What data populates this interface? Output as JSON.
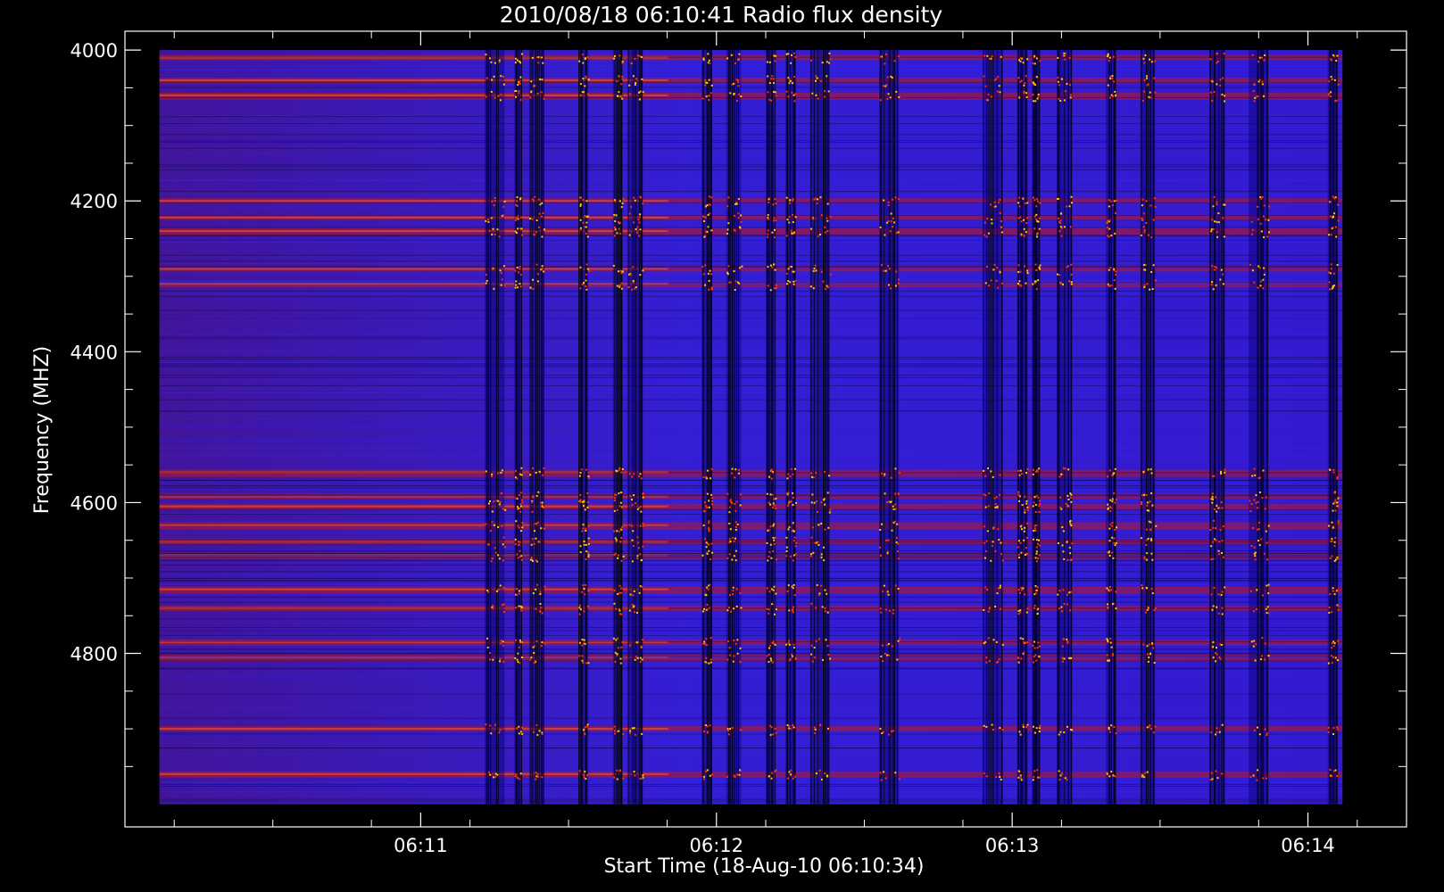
{
  "chart_data": {
    "type": "heatmap",
    "title": "2010/08/18 06:10:41 Radio flux density",
    "xlabel": "Start Time (18-Aug-10 06:10:34)",
    "ylabel": "Frequency (MHZ)",
    "x_ticks": [
      "06:11",
      "06:12",
      "06:13",
      "06:14"
    ],
    "y_ticks": [
      "4000",
      "4200",
      "4400",
      "4600",
      "4800"
    ],
    "x_tick_times_s": [
      60,
      120,
      180,
      240
    ],
    "xlim_s": [
      0,
      260
    ],
    "data_time_range_s": [
      7,
      247
    ],
    "y_tick_values": [
      4000,
      4200,
      4400,
      4600,
      4800
    ],
    "ylim": [
      3975,
      5030
    ],
    "data_freq_range": [
      4000,
      5000
    ],
    "grid": false,
    "colorscale": [
      "#000000",
      "#0000ff",
      "#cc0000",
      "#ffcc00"
    ],
    "background_color": "#4a1aa8",
    "bright_bands_mhz": [
      4010,
      4040,
      4060,
      4200,
      4222,
      4240,
      4290,
      4310,
      4560,
      4592,
      4605,
      4630,
      4652,
      4670,
      4715,
      4740,
      4785,
      4805,
      4900,
      4960
    ],
    "burst_intervals_s": [
      [
        73,
        77
      ],
      [
        79,
        80.5
      ],
      [
        82,
        85
      ],
      [
        92,
        94
      ],
      [
        99,
        101
      ],
      [
        102,
        105
      ],
      [
        117,
        119
      ],
      [
        122,
        125
      ],
      [
        130,
        132
      ],
      [
        134,
        136
      ],
      [
        139,
        143
      ],
      [
        153,
        157
      ],
      [
        174,
        178
      ],
      [
        181,
        183
      ],
      [
        184,
        185.5
      ],
      [
        189,
        192
      ],
      [
        199,
        201
      ],
      [
        206,
        209
      ],
      [
        220,
        223
      ],
      [
        228,
        232
      ],
      [
        244,
        246
      ]
    ]
  }
}
